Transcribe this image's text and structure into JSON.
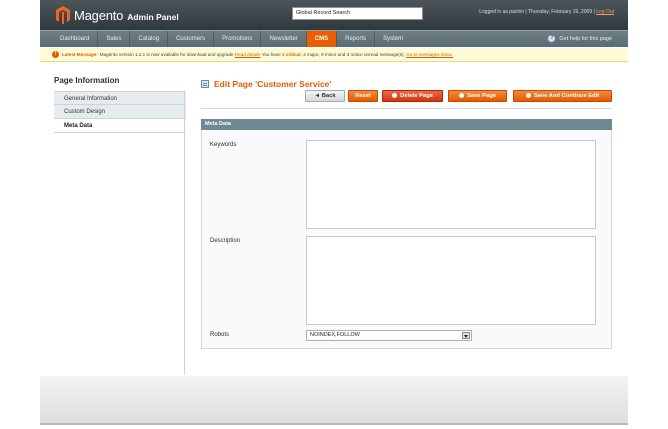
{
  "header": {
    "logo_text": "Magento",
    "logo_sub": "Admin Panel",
    "search_value": "Global Record Search",
    "logged_in": "Logged in as pachin",
    "date": "Thursday, February 19, 2009",
    "logout": "Log Out"
  },
  "nav": {
    "items": [
      "Dashboard",
      "Sales",
      "Catalog",
      "Customers",
      "Promotions",
      "Newsletter",
      "CMS",
      "Reports",
      "System"
    ],
    "active": "CMS",
    "help": "Get help for this page"
  },
  "notice": {
    "label": "Latest Message:",
    "text": "Magento version 1.2.1 is now available for download and upgrade",
    "read_details": "Read details",
    "have": "You have",
    "critical": "1 critical",
    "major": "2 major",
    "minor": "9 minor",
    "notice_count": "3 notice",
    "unread": "unread message(s).",
    "goto": "Go to messages inbox."
  },
  "sidebar": {
    "title": "Page Information",
    "tabs": [
      "General Information",
      "Custom Design",
      "Meta Data"
    ],
    "active_index": 2
  },
  "main": {
    "title": "Edit Page 'Customer Service'",
    "buttons": {
      "back": "Back",
      "reset": "Reset",
      "delete": "Delete Page",
      "save": "Save Page",
      "save_continue": "Save And Continue Edit"
    },
    "section_title": "Meta Data",
    "fields": {
      "keywords_label": "Keywords",
      "keywords_value": "",
      "description_label": "Description",
      "description_value": "",
      "robots_label": "Robots",
      "robots_value": "NOINDEX,FOLLOW"
    }
  },
  "colors": {
    "accent": "#e55a00",
    "header_bg": "#3a4448",
    "nav_bg": "#627279",
    "section_head": "#6f8992",
    "notice_bg": "#fffbd6"
  },
  "icons": [
    "magento-logo-icon",
    "help-icon",
    "warning-icon",
    "page-icon",
    "back-icon",
    "delete-icon",
    "save-icon",
    "select-arrow-icon"
  ]
}
